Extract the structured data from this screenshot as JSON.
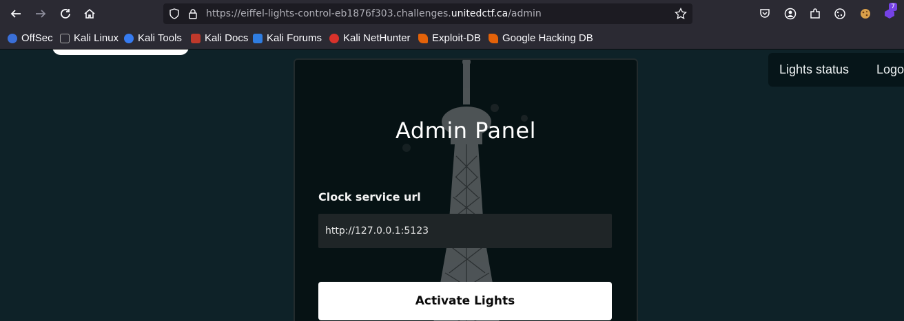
{
  "browser": {
    "url_prefix": "https://eiffel-lights-control-eb1876f303.challenges.",
    "url_host": "unitedctf.ca",
    "url_path": "/admin",
    "extension_badge": "7",
    "bookmarks": [
      {
        "label": "OffSec",
        "color": "#3a6fd8"
      },
      {
        "label": "Kali Linux",
        "color": "#2b2a33"
      },
      {
        "label": "Kali Tools",
        "color": "#367bf0"
      },
      {
        "label": "Kali Docs",
        "color": "#c0392b"
      },
      {
        "label": "Kali Forums",
        "color": "#2f7de1"
      },
      {
        "label": "Kali NetHunter",
        "color": "#d9322b"
      },
      {
        "label": "Exploit-DB",
        "color": "#e36209"
      },
      {
        "label": "Google Hacking DB",
        "color": "#e36209"
      }
    ]
  },
  "nav": {
    "lights_status": "Lights status",
    "logout": "Logout"
  },
  "panel": {
    "title": "Admin Panel",
    "field_label": "Clock service url",
    "field_value": "http://127.0.0.1:5123",
    "button_label": "Activate Lights"
  },
  "colors": {
    "page_bg": "#0e2228",
    "card_bg": "#061214",
    "button_bg": "#ffffff"
  }
}
